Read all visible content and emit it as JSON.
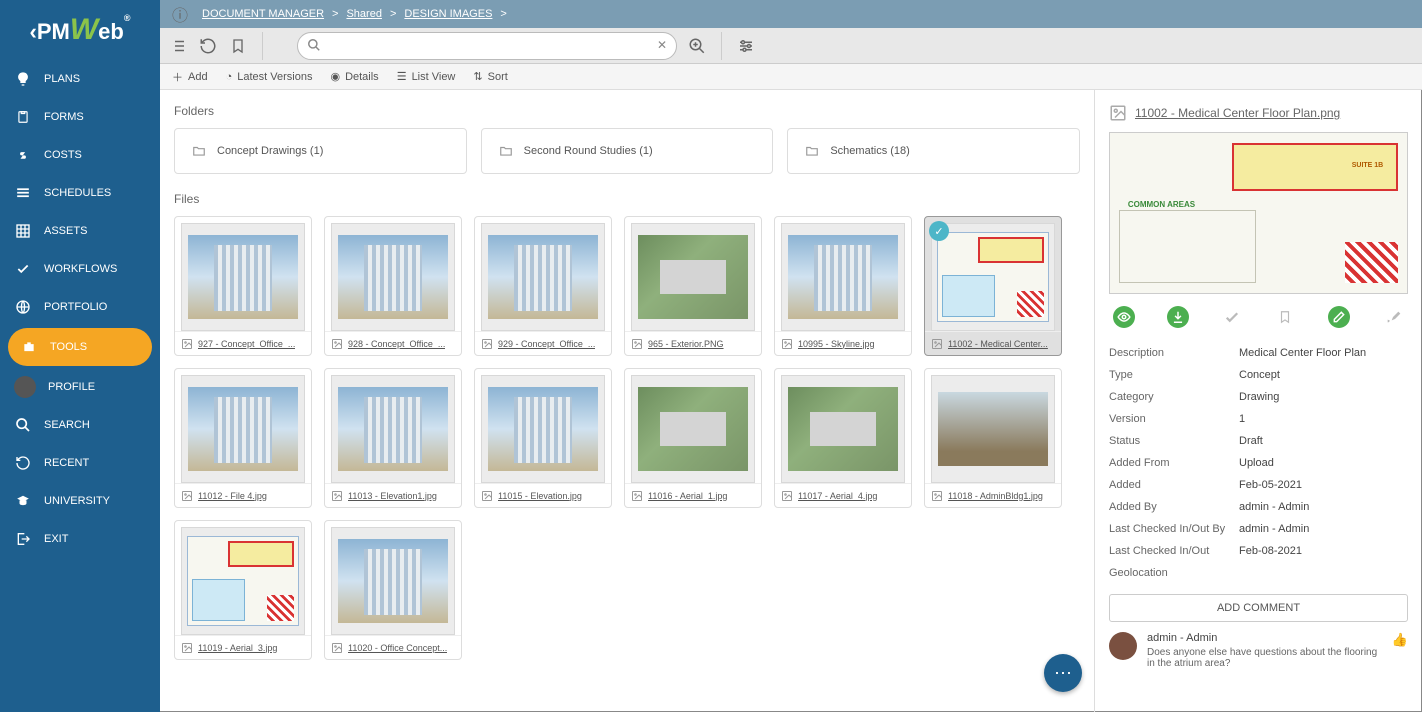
{
  "logo": {
    "pm": "PM",
    "w": "W",
    "eb": "eb",
    "reg": "®"
  },
  "sidebar": {
    "items": [
      {
        "label": "PLANS",
        "icon": "lightbulb"
      },
      {
        "label": "FORMS",
        "icon": "clipboard"
      },
      {
        "label": "COSTS",
        "icon": "dollar"
      },
      {
        "label": "SCHEDULES",
        "icon": "bars"
      },
      {
        "label": "ASSETS",
        "icon": "grid"
      },
      {
        "label": "WORKFLOWS",
        "icon": "check"
      },
      {
        "label": "PORTFOLIO",
        "icon": "globe"
      },
      {
        "label": "TOOLS",
        "icon": "briefcase",
        "active": true
      },
      {
        "label": "PROFILE",
        "icon": "avatar"
      },
      {
        "label": "SEARCH",
        "icon": "magnify"
      },
      {
        "label": "RECENT",
        "icon": "history"
      },
      {
        "label": "UNIVERSITY",
        "icon": "gradcap"
      },
      {
        "label": "EXIT",
        "icon": "exit"
      }
    ]
  },
  "breadcrumb": {
    "items": [
      "DOCUMENT MANAGER",
      "Shared",
      "DESIGN IMAGES"
    ],
    "sep": ">"
  },
  "toolbar": {
    "search_placeholder": ""
  },
  "subtoolbar": {
    "add": "Add",
    "latest": "Latest Versions",
    "details": "Details",
    "listview": "List View",
    "sort": "Sort"
  },
  "sections": {
    "folders": "Folders",
    "files": "Files"
  },
  "folders": [
    {
      "name": "Concept Drawings (1)"
    },
    {
      "name": "Second Round Studies (1)"
    },
    {
      "name": "Schematics (18)"
    }
  ],
  "files": [
    {
      "name": "927 - Concept_Office_...",
      "thumb": "building"
    },
    {
      "name": "928 - Concept_Office_...",
      "thumb": "building"
    },
    {
      "name": "929 - Concept_Office_...",
      "thumb": "building"
    },
    {
      "name": "965 - Exterior.PNG",
      "thumb": "aerial"
    },
    {
      "name": "10995 - Skyline.jpg",
      "thumb": "building"
    },
    {
      "name": "11002 - Medical Center...",
      "thumb": "floorplan",
      "selected": true
    },
    {
      "name": "11012 - File 4.jpg",
      "thumb": "building"
    },
    {
      "name": "11013 - Elevation1.jpg",
      "thumb": "building"
    },
    {
      "name": "11015 - Elevation.jpg",
      "thumb": "building"
    },
    {
      "name": "11016 - Aerial_1.jpg",
      "thumb": "aerial"
    },
    {
      "name": "11017 - Aerial_4.jpg",
      "thumb": "aerial"
    },
    {
      "name": "11018 - AdminBldg1.jpg",
      "thumb": "low"
    },
    {
      "name": "11019 - Aerial_3.jpg",
      "thumb": "floorplan"
    },
    {
      "name": "11020 - Office Concept...",
      "thumb": "building"
    }
  ],
  "details": {
    "title": "11002 - Medical Center Floor Plan.png",
    "common_label": "COMMON AREAS",
    "suite_label": "SUITE 1B",
    "meta": [
      {
        "label": "Description",
        "value": "Medical Center Floor Plan"
      },
      {
        "label": "Type",
        "value": "Concept"
      },
      {
        "label": "Category",
        "value": "Drawing"
      },
      {
        "label": "Version",
        "value": "1"
      },
      {
        "label": "Status",
        "value": "Draft"
      },
      {
        "label": "Added From",
        "value": "Upload"
      },
      {
        "label": "Added",
        "value": "Feb-05-2021"
      },
      {
        "label": "Added By",
        "value": "admin - Admin"
      },
      {
        "label": "Last Checked In/Out By",
        "value": "admin - Admin"
      },
      {
        "label": "Last Checked In/Out",
        "value": "Feb-08-2021"
      },
      {
        "label": "Geolocation",
        "value": ""
      }
    ],
    "add_comment": "ADD COMMENT",
    "comment": {
      "author": "admin - Admin",
      "text": "Does anyone else have questions about the flooring in the atrium area?"
    }
  }
}
